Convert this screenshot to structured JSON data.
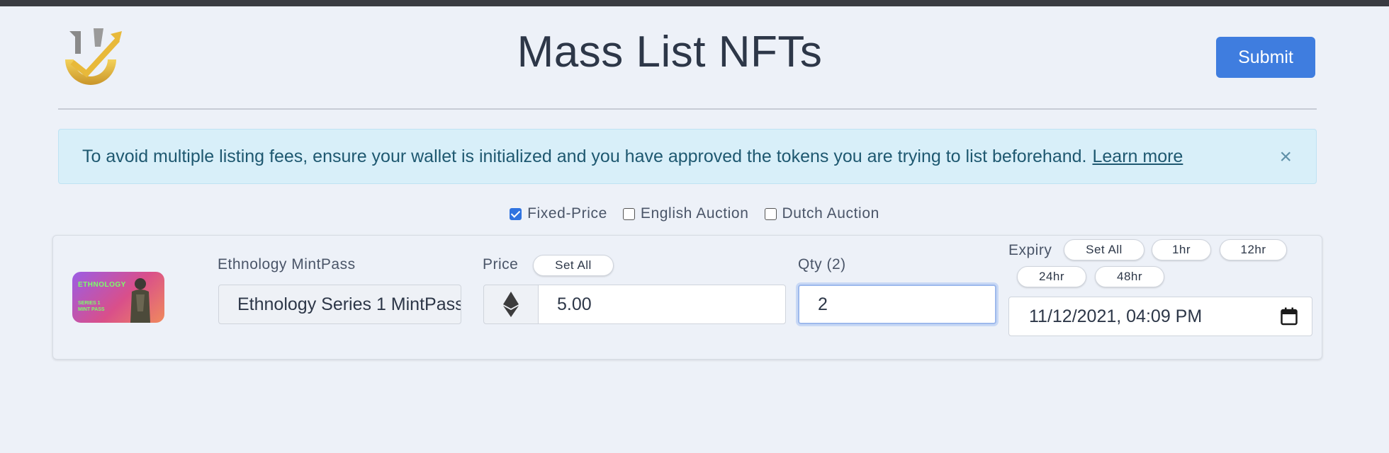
{
  "header": {
    "title": "Mass List NFTs",
    "submit_label": "Submit"
  },
  "alert": {
    "message": "To avoid multiple listing fees, ensure your wallet is initialized and you have approved the tokens you are trying to list beforehand.",
    "link_label": "Learn more",
    "close_label": "×"
  },
  "listing_types": [
    {
      "label": "Fixed-Price",
      "checked": true
    },
    {
      "label": "English Auction",
      "checked": false
    },
    {
      "label": "Dutch Auction",
      "checked": false
    }
  ],
  "item": {
    "collection_label": "Ethnology MintPass",
    "name_value": "Ethnology Series 1 MintPass",
    "thumb_title": "ETHNOLOGY",
    "thumb_sub1": "SERIES 1",
    "thumb_sub2": "MINT PASS",
    "price_label": "Price",
    "price_set_all": "Set All",
    "price_value": "5.00",
    "currency_icon": "ethereum-icon",
    "qty_label": "Qty (2)",
    "qty_value": "2",
    "expiry_label": "Expiry",
    "expiry_presets": [
      "Set All",
      "1hr",
      "12hr",
      "24hr",
      "48hr"
    ],
    "expiry_value": "11/12/2021, 04:09 PM"
  },
  "colors": {
    "accent": "#3f7ddf",
    "alert_bg": "#d8eff9",
    "background": "#edf1f8"
  }
}
